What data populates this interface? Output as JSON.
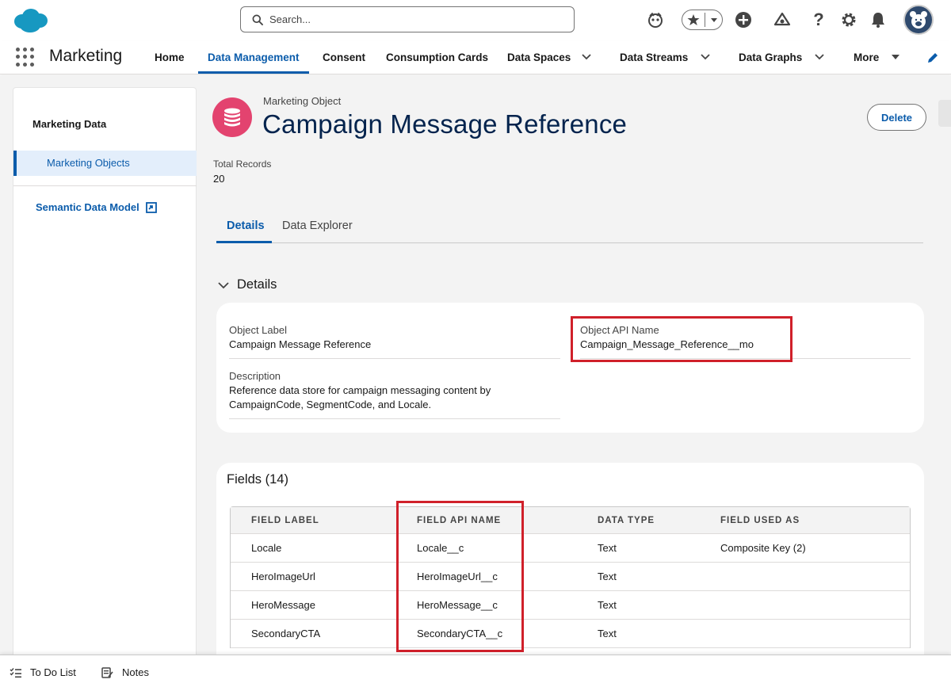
{
  "header": {
    "search_placeholder": "Search..."
  },
  "nav": {
    "app_name": "Marketing",
    "items": [
      {
        "label": "Home"
      },
      {
        "label": "Data Management"
      },
      {
        "label": "Consent"
      },
      {
        "label": "Consumption Cards"
      },
      {
        "label": "Data Spaces"
      },
      {
        "label": "Data Streams"
      },
      {
        "label": "Data Graphs"
      },
      {
        "label": "More"
      }
    ],
    "active_index": 1
  },
  "sidebar": {
    "title": "Marketing Data",
    "active_item": "Marketing Objects",
    "link": "Semantic Data Model"
  },
  "record": {
    "object_type": "Marketing Object",
    "title": "Campaign Message Reference",
    "delete_label": "Delete",
    "total_records_label": "Total Records",
    "total_records_value": "20"
  },
  "tabs": [
    "Details",
    "Data Explorer"
  ],
  "details": {
    "section_title": "Details",
    "object_label_label": "Object Label",
    "object_label_value": "Campaign Message Reference",
    "api_name_label": "Object API Name",
    "api_name_value": "Campaign_Message_Reference__mo",
    "description_label": "Description",
    "description_line1": "Reference data store for campaign messaging content by",
    "description_line2": "CampaignCode, SegmentCode, and Locale."
  },
  "fields": {
    "title": "Fields (14)",
    "columns": [
      "FIELD LABEL",
      "FIELD API NAME",
      "DATA TYPE",
      "FIELD USED AS"
    ],
    "rows": [
      [
        "Locale",
        "Locale__c",
        "Text",
        "Composite Key (2)"
      ],
      [
        "HeroImageUrl",
        "HeroImageUrl__c",
        "Text",
        ""
      ],
      [
        "HeroMessage",
        "HeroMessage__c",
        "Text",
        ""
      ],
      [
        "SecondaryCTA",
        "SecondaryCTA__c",
        "Text",
        ""
      ]
    ]
  },
  "utility_bar": {
    "todo_label": "To Do List",
    "notes_label": "Notes"
  },
  "colors": {
    "brand_blue": "#0b5cab",
    "title_navy": "#03234d",
    "object_icon": "#e3436f",
    "highlight_red": "#d0202a"
  },
  "icons": [
    "salesforce-cloud-icon",
    "search-icon",
    "einstein-icon",
    "favorite-star-icon",
    "add-icon",
    "trailhead-icon",
    "help-icon",
    "setup-gear-icon",
    "notifications-bell-icon",
    "user-avatar-icon",
    "app-launcher-icon",
    "edit-pencil-icon",
    "database-icon",
    "external-link-icon",
    "todo-list-icon",
    "notes-icon"
  ]
}
